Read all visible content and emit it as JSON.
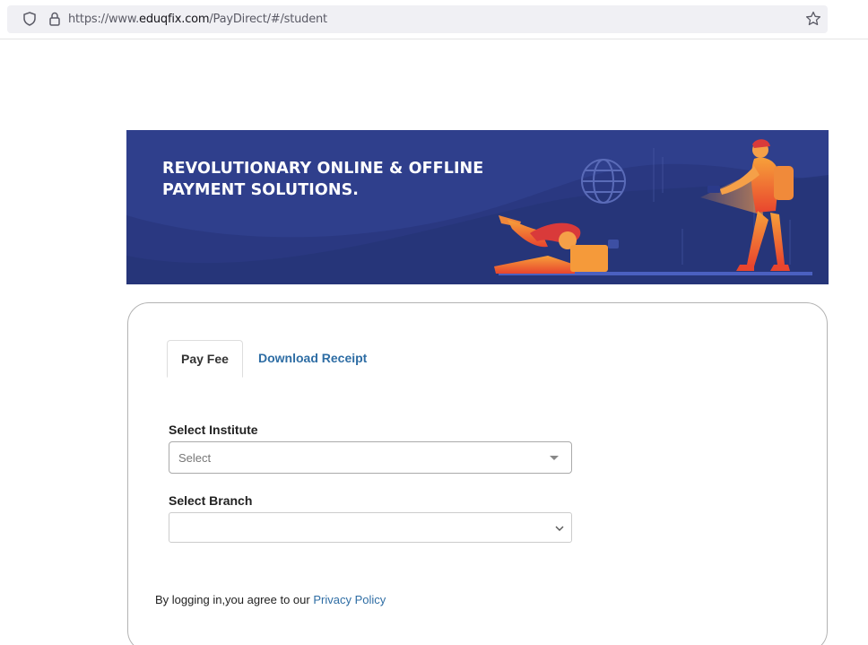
{
  "browser": {
    "url_prefix": "https://www.",
    "url_domain": "eduqfix.com",
    "url_path": "/PayDirect/#/student",
    "icons": [
      "shield-icon",
      "lock-icon",
      "star-bookmark-icon"
    ]
  },
  "banner": {
    "title_line1": "REVOLUTIONARY ONLINE & OFFLINE",
    "title_line2": "PAYMENT SOLUTIONS.",
    "background_color": "#2f3f8c"
  },
  "tabs": [
    {
      "label": "Pay Fee",
      "active": true
    },
    {
      "label": "Download Receipt",
      "active": false
    }
  ],
  "form": {
    "institute": {
      "label": "Select Institute",
      "placeholder": "Select"
    },
    "branch": {
      "label": "Select Branch",
      "value": ""
    }
  },
  "footer": {
    "agree_text": "By logging in,you agree to our ",
    "privacy_link": "Privacy Policy"
  },
  "colors": {
    "link": "#2e6da4",
    "banner": "#2f3f8c",
    "accent": "#f28a3c"
  }
}
